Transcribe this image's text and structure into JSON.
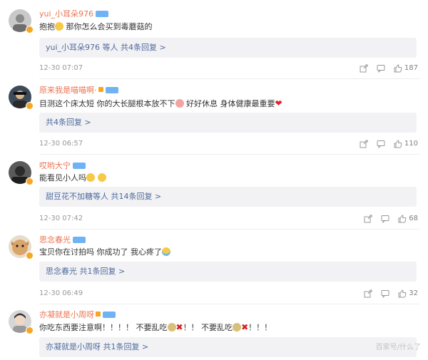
{
  "comments": [
    {
      "username": "yui_小耳朵976",
      "text_before": "抱抱",
      "text_after": " 那你怎么会买到毒蘑菇的",
      "reply_link": "yui_小耳朵976 等人  共4条回复 >",
      "time": "12-30 07:07",
      "likes": "187"
    },
    {
      "username": "原来我是喵喵啊·",
      "text_part1": "目测这个床太短 你的大长腿根本放不下",
      "text_part2": " 好好休息 身体健康最重要",
      "reply_link": "共4条回复 >",
      "time": "12-30 06:57",
      "likes": "110"
    },
    {
      "username": "哎哟大宁",
      "text": "能看见小人吗",
      "reply_link": "甜豆花不加糖等人  共14条回复 >",
      "time": "12-30 07:42",
      "likes": "68"
    },
    {
      "username": "思念春光",
      "text": "宝贝你在讨拍吗 你成功了 我心疼了",
      "reply_link": "思念春光  共1条回复 >",
      "time": "12-30 06:49",
      "likes": "32"
    },
    {
      "username": "亦凝就是小周呀",
      "text_part1": "你吃东西要注意啊！！！！ 不要乱吃",
      "text_part2": "！！ 不要乱吃",
      "text_part3": "！！！",
      "reply_link": "亦凝就是小周呀  共1条回复 >"
    }
  ],
  "watermark": "百家号/什么了",
  "colors": {
    "username": "#eb7350",
    "link": "#4f6b9c",
    "reply_bg": "#f2f2f5",
    "verified_badge": "#f5a623"
  },
  "icons": [
    "share-icon",
    "comment-icon",
    "like-icon",
    "verified-badge-icon"
  ]
}
